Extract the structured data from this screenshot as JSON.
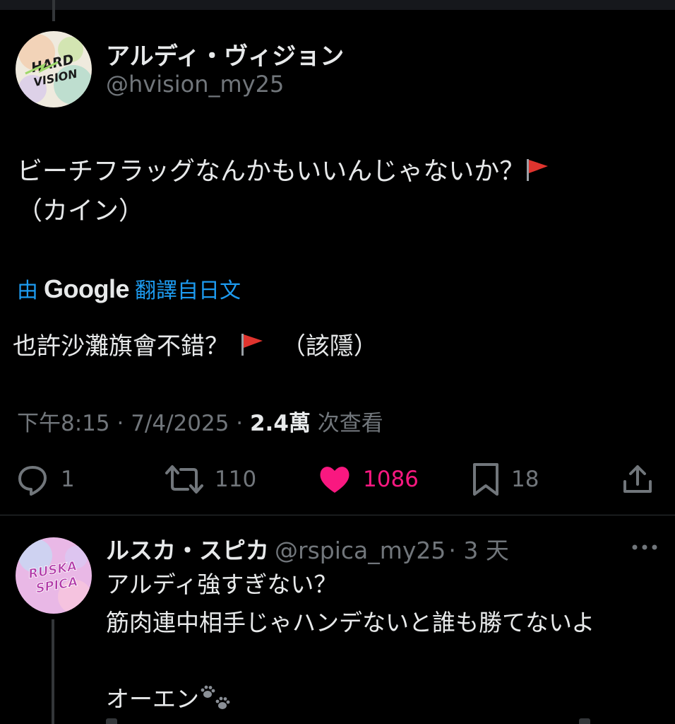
{
  "tweet": {
    "author": {
      "name": "アルディ・ヴィジョン",
      "handle": "@hvision_my25",
      "avatar_icon": "hard-vision-avatar"
    },
    "text_line1": "ビーチフラッグなんかもいいんじゃないか？",
    "text_line2": "（カイン）",
    "translation": {
      "prefix": "由",
      "provider": "Google",
      "suffix": "翻譯自日文",
      "text": "也許沙灘旗會不錯？",
      "text_tail": "（該隱）"
    },
    "meta": {
      "time": "下午8:15",
      "date": "7/4/2025",
      "views_count": "2.4萬",
      "views_label": "次查看"
    },
    "actions": {
      "replies": "1",
      "retweets": "110",
      "likes": "1086",
      "bookmarks": "18"
    }
  },
  "reply": {
    "author": {
      "name": "ルスカ・スピカ",
      "handle": "@rspica_my25",
      "avatar_icon": "ruska-spica-avatar"
    },
    "time_ago": "· 3 天",
    "lines": [
      "アルディ強すぎない？",
      "筋肉連中相手じゃハンデないと誰も勝てないよ",
      "",
      "オーエン"
    ]
  },
  "colors": {
    "accent": "#1d9bf0",
    "like": "#f91880",
    "secondary_text": "#71767b",
    "flag_red": "#e0342e"
  }
}
